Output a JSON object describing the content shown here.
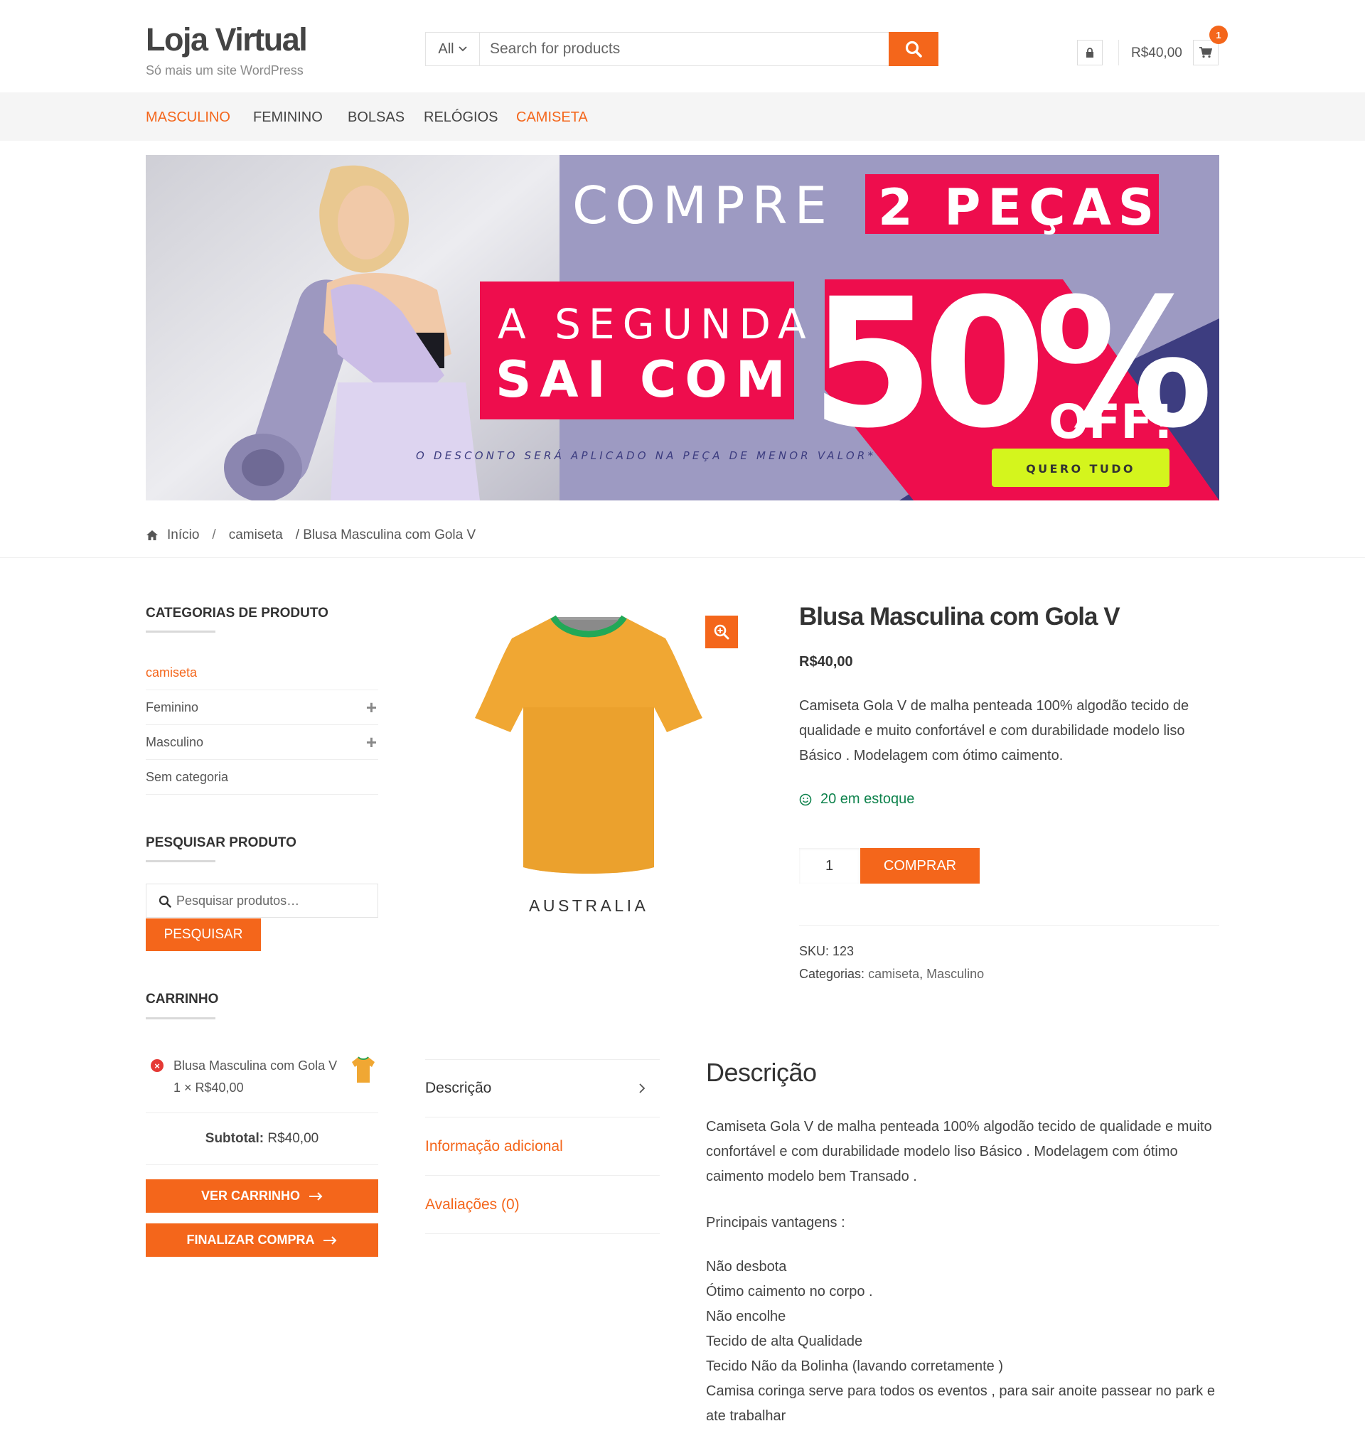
{
  "site": {
    "title": "Loja Virtual",
    "tagline": "Só mais um site WordPress"
  },
  "header": {
    "search_category": "All",
    "search_placeholder": "Search for products",
    "cart_total": "R$40,00",
    "cart_count": "1"
  },
  "nav": [
    {
      "label": "MASCULINO",
      "active": true
    },
    {
      "label": "FEMININO",
      "active": false
    },
    {
      "label": "BOLSAS",
      "active": false
    },
    {
      "label": "RELÓGIOS",
      "active": false
    },
    {
      "label": "CAMISETA",
      "active": true
    }
  ],
  "banner": {
    "line1_a": "COMPRE",
    "line1_b": "2 PEÇAS",
    "line2": "A SEGUNDA",
    "line3": "SAI COM",
    "big_number": "50%",
    "off": "OFF!",
    "note": "O DESCONTO SERÁ APLICADO NA PEÇA DE MENOR VALOR*",
    "cta": "QUERO TUDO"
  },
  "breadcrumb": {
    "home": "Início",
    "category": "camiseta",
    "current": "/ Blusa Masculina com Gola V"
  },
  "sidebar": {
    "categories_title": "CATEGORIAS DE PRODUTO",
    "categories": [
      {
        "label": "camiseta"
      },
      {
        "label": "Feminino"
      },
      {
        "label": "Masculino"
      },
      {
        "label": "Sem categoria"
      }
    ],
    "search_title": "PESQUISAR PRODUTO",
    "search_placeholder": "Pesquisar produtos…",
    "search_button": "PESQUISAR",
    "cart_title": "CARRINHO",
    "cart_item_name": "Blusa Masculina com Gola V",
    "cart_item_qty": "1 × R$40,00",
    "subtotal_label": "Subtotal:",
    "subtotal_value": "R$40,00",
    "view_cart": "VER CARRINHO",
    "checkout": "FINALIZAR COMPRA"
  },
  "product": {
    "image_caption": "AUSTRALIA",
    "title": "Blusa Masculina com Gola V",
    "price": "R$40,00",
    "short_description": "Camiseta Gola V de malha penteada 100% algodão tecido de qualidade e muito confortável e com durabilidade modelo liso Básico . Modelagem com ótimo caimento.",
    "stock": "20 em estoque",
    "quantity": "1",
    "buy_button": "COMPRAR",
    "sku_label": "SKU:",
    "sku_value": "123",
    "categories_label": "Categorias:",
    "category_1": "camiseta",
    "category_2": "Masculino"
  },
  "tabs": [
    {
      "label": "Descrição"
    },
    {
      "label": "Informação adicional"
    },
    {
      "label": "Avaliações (0)"
    }
  ],
  "description": {
    "title": "Descrição",
    "paragraph": "Camiseta Gola V de malha penteada 100% algodão tecido de qualidade e muito confortável e com durabilidade modelo liso Básico . Modelagem com ótimo caimento modelo bem Transado .",
    "advantages_title": "Principais vantagens :",
    "advantages": [
      "Não desbota",
      "Ótimo caimento no corpo .",
      "Não encolhe",
      "Tecido de alta Qualidade",
      "Tecido Não da Bolinha (lavando corretamente )",
      "Camisa coringa serve para todos os eventos , para sair anoite passear no park e ate trabalhar"
    ]
  },
  "colors": {
    "accent": "#f4661b",
    "banner_pink": "#ee0d4d",
    "banner_lavender": "#9d9ac2",
    "banner_navy": "#3d3d80",
    "cta_yellow": "#d4f51d",
    "stock_green": "#0f834d"
  }
}
